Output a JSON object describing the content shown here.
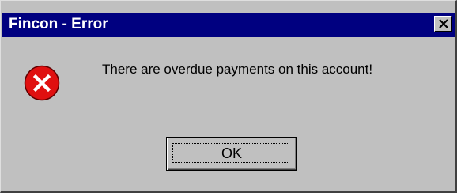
{
  "window": {
    "title": "Fincon - Error",
    "colors": {
      "titlebar": "#000080",
      "face": "#c0c0c0",
      "error_icon": "#e01010"
    }
  },
  "title_bar": {
    "close_icon": "close-icon"
  },
  "dialog": {
    "icon": "error-icon",
    "message": "There are overdue payments on this account!",
    "ok_label": "OK"
  }
}
